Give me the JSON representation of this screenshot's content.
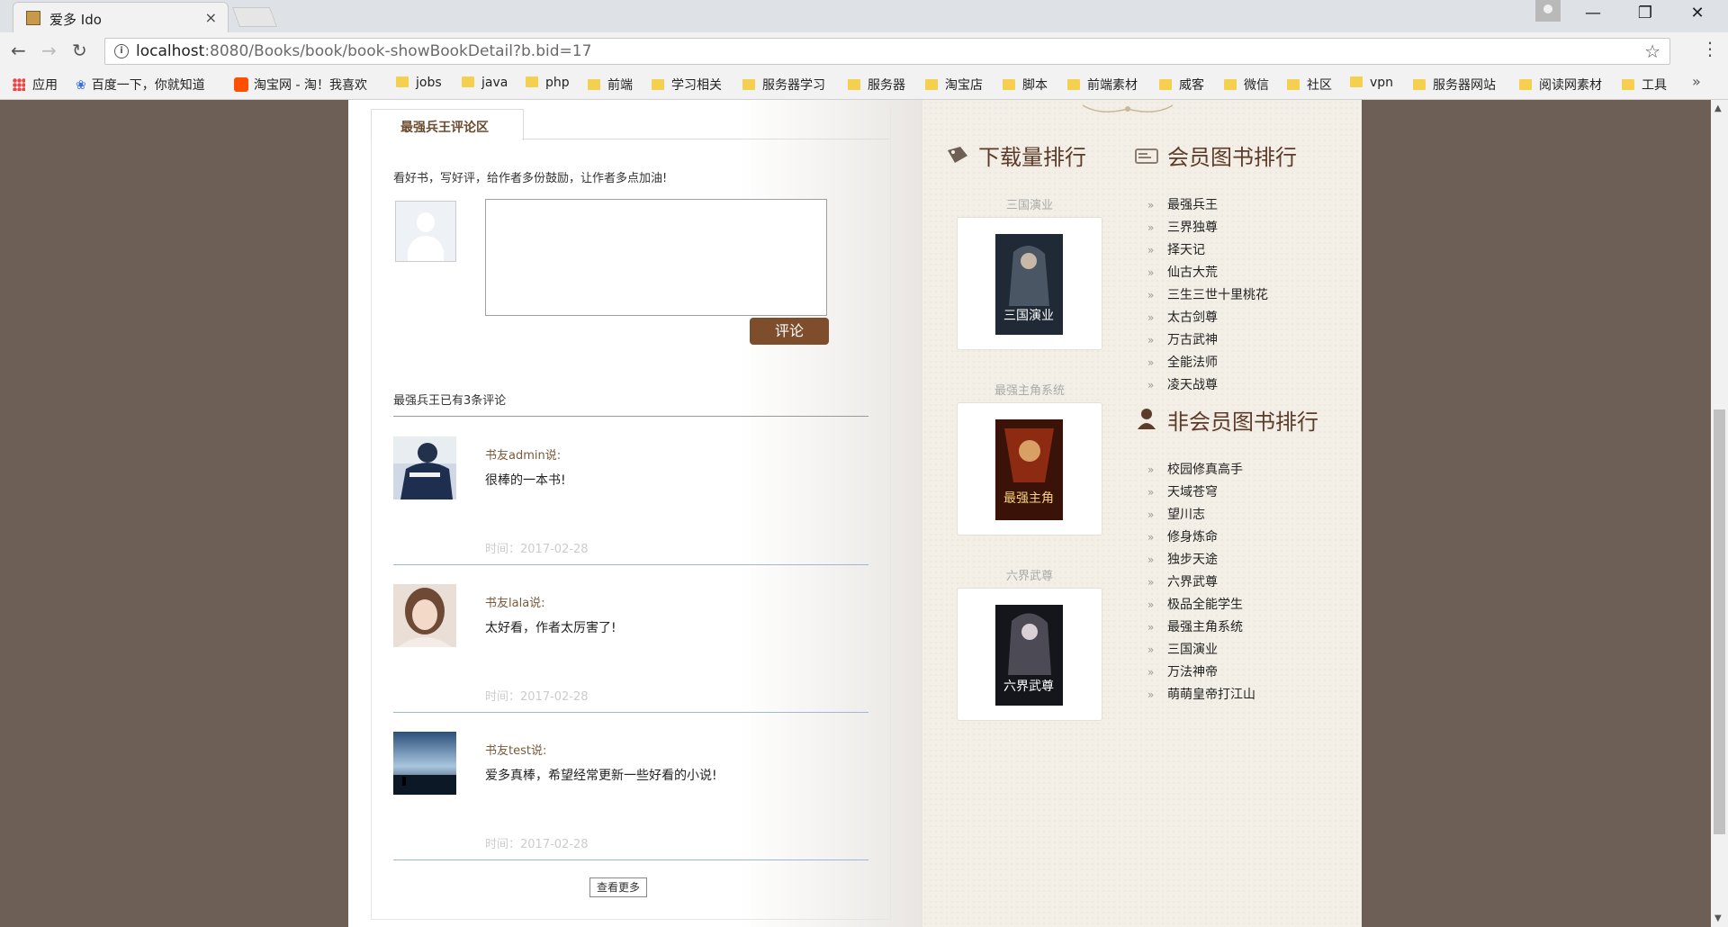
{
  "browser": {
    "tab_title": "爱多 Ido",
    "tab_close": "×",
    "url_host": "localhost",
    "url_path": ":8080/Books/book/book-showBookDetail?b.bid=17",
    "bookmarks": [
      "应用",
      "百度一下，你就知道",
      "淘宝网 - 淘！我喜欢",
      "jobs",
      "java",
      "php",
      "前端",
      "学习相关",
      "服务器学习",
      "服务器",
      "淘宝店",
      "脚本",
      "前端素材",
      "威客",
      "微信",
      "社区",
      "vpn",
      "服务器网站",
      "阅读网素材",
      "工具"
    ],
    "bookmarks_more": "»"
  },
  "review": {
    "tab_label": "最强兵王评论区",
    "prompt": "看好书，写好评，给作者多份鼓励，让作者多点加油!",
    "submit_label": "评论",
    "count_text": "最强兵王已有3条评论",
    "comments": [
      {
        "user": "书友admin说:",
        "text": "很棒的一本书!",
        "time": "时间：2017-02-28"
      },
      {
        "user": "书友lala说:",
        "text": "太好看，作者太厉害了!",
        "time": "时间：2017-02-28"
      },
      {
        "user": "书友test说:",
        "text": "爱多真棒，希望经常更新一些好看的小说!",
        "time": "时间：2017-02-28"
      }
    ],
    "more_label": "查看更多"
  },
  "download_rank": {
    "title": "下载量排行",
    "books": [
      {
        "name": "三国演业",
        "cover_text": "三国演业"
      },
      {
        "name": "最强主角系统",
        "cover_text": "最强主角"
      },
      {
        "name": "六界武尊",
        "cover_text": "六界武尊"
      }
    ]
  },
  "member_rank": {
    "title": "会员图书排行",
    "items": [
      "最强兵王",
      "三界独尊",
      "择天记",
      "仙古大荒",
      "三生三世十里桃花",
      "太古剑尊",
      "万古武神",
      "全能法师",
      "凌天战尊"
    ]
  },
  "nonmember_rank": {
    "title": "非会员图书排行",
    "items": [
      "校园修真高手",
      "天域苍穹",
      "望川志",
      "修身炼命",
      "独步天途",
      "六界武尊",
      "极品全能学生",
      "最强主角系统",
      "三国演业",
      "万法神帝",
      "萌萌皇帝打江山"
    ]
  },
  "colors": {
    "accent": "#7e4e2c",
    "page_bg": "#6d5e56",
    "panel_bg": "#f3efe6"
  }
}
